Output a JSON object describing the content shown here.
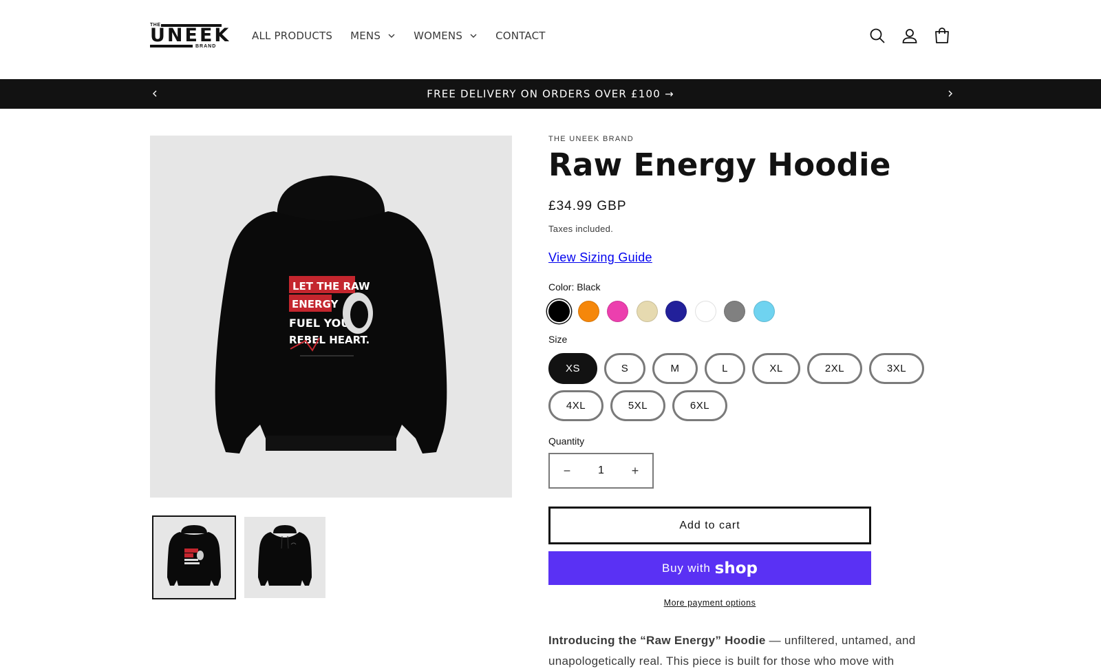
{
  "header": {
    "logo": {
      "top": "THE",
      "word": "UNEEK",
      "bottom": "BRAND"
    },
    "nav": [
      {
        "label": "ALL PRODUCTS",
        "has_dropdown": false
      },
      {
        "label": "MENS",
        "has_dropdown": true
      },
      {
        "label": "WOMENS",
        "has_dropdown": true
      },
      {
        "label": "CONTACT",
        "has_dropdown": false
      }
    ],
    "icons": [
      "search-icon",
      "account-icon",
      "cart-icon"
    ]
  },
  "announcement": {
    "text": "FREE DELIVERY ON ORDERS OVER £100",
    "arrow": "→"
  },
  "media": {
    "print_lines": [
      "LET THE RAW",
      "ENERGY",
      "FUEL YOUR",
      "REBEL HEART."
    ],
    "print_color": "#c4262e"
  },
  "product": {
    "vendor": "THE UNEEK BRAND",
    "title": "Raw Energy Hoodie",
    "price": "£34.99 GBP",
    "taxes": "Taxes included.",
    "sizing_link": "View Sizing Guide",
    "color_label": "Color: Black",
    "colors": [
      {
        "name": "Black",
        "hex": "#000000",
        "selected": true
      },
      {
        "name": "Orange",
        "hex": "#f5870a",
        "selected": false
      },
      {
        "name": "Pink",
        "hex": "#ec3fae",
        "selected": false
      },
      {
        "name": "Sand",
        "hex": "#e6dab0",
        "selected": false
      },
      {
        "name": "Navy",
        "hex": "#22209a",
        "selected": false
      },
      {
        "name": "White",
        "hex": "#ffffff",
        "selected": false
      },
      {
        "name": "Grey",
        "hex": "#808080",
        "selected": false
      },
      {
        "name": "Sky Blue",
        "hex": "#6fd3f0",
        "selected": false
      }
    ],
    "size_label": "Size",
    "sizes": [
      {
        "label": "XS",
        "selected": true
      },
      {
        "label": "S",
        "selected": false
      },
      {
        "label": "M",
        "selected": false
      },
      {
        "label": "L",
        "selected": false
      },
      {
        "label": "XL",
        "selected": false
      },
      {
        "label": "2XL",
        "selected": false
      },
      {
        "label": "3XL",
        "selected": false
      },
      {
        "label": "4XL",
        "selected": false
      },
      {
        "label": "5XL",
        "selected": false
      },
      {
        "label": "6XL",
        "selected": false
      }
    ],
    "quantity_label": "Quantity",
    "quantity": "1",
    "minus": "−",
    "plus": "+",
    "add_to_cart": "Add to cart",
    "buy_with": "Buy with",
    "shop_word": "shop",
    "more_payment": "More payment options",
    "description": {
      "bold": "Introducing the “Raw Energy” Hoodie",
      "rest": " — unfiltered, untamed, and unapologetically real. This piece is built for those who move with"
    }
  },
  "colors": {
    "text": "#121212",
    "announcement_bg": "#121212",
    "shop_purple": "#5a31f4",
    "link": "#0000ee",
    "media_bg": "#e6e6e6"
  }
}
